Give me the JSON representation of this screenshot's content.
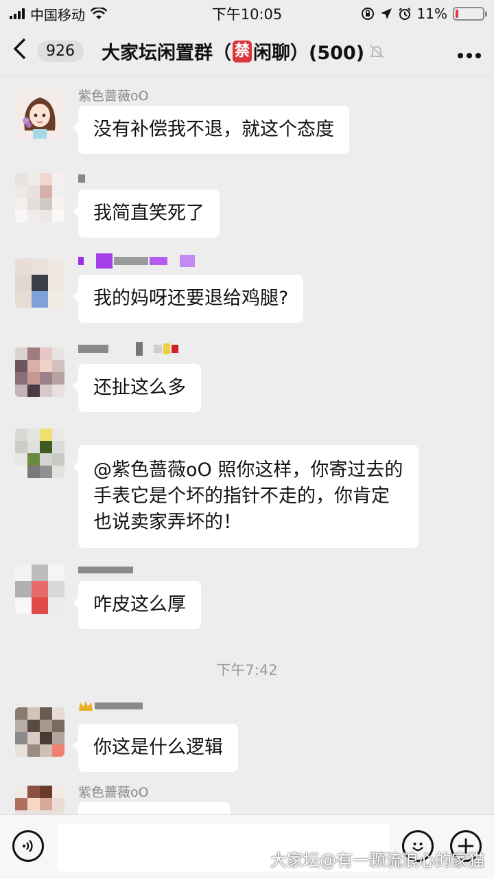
{
  "status_bar": {
    "carrier": "中国移动",
    "time": "下午10:05",
    "battery_percent": "11%",
    "battery_level": 0.11
  },
  "header": {
    "back_badge": "926",
    "title_prefix": "大家坛闲置群（",
    "forbid_char": "禁",
    "title_suffix": "闲聊）(500)"
  },
  "messages": [
    {
      "sender": "紫色蔷薇oO",
      "text": "没有补偿我不退，就这个态度"
    },
    {
      "sender": "",
      "text": "我简直笑死了"
    },
    {
      "sender": "",
      "text": "我的妈呀还要退给鸡腿?"
    },
    {
      "sender": "",
      "text": "还扯这么多"
    },
    {
      "sender": "",
      "text": "@紫色蔷薇oO 照你这样，你寄过去的手表它是个坏的指针不走的，你肯定也说卖家弄坏的！"
    },
    {
      "sender": "",
      "text": "咋皮这么厚"
    },
    {
      "sender": "",
      "text": "你这是什么逻辑"
    },
    {
      "sender": "紫色蔷薇oO",
      "text": ""
    }
  ],
  "timestamp": "下午7:42",
  "watermark": "大家坛@有一颗流浪心的家猫",
  "icons": {
    "back": "chevron-left-icon",
    "mute": "bell-slash-icon",
    "more": "more-icon",
    "voice": "voice-icon",
    "emoji": "emoji-icon",
    "plus": "plus-icon"
  },
  "colors": {
    "background": "#ededed",
    "bubble": "#ffffff",
    "forbid_badge": "#d9363e",
    "battery_low": "#e53935"
  }
}
